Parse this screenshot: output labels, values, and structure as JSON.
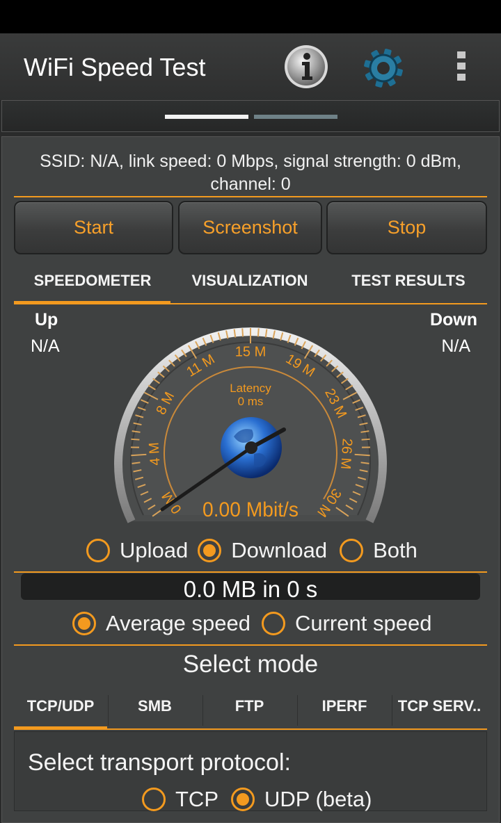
{
  "app": {
    "title": "WiFi Speed Test",
    "icons": [
      "info-icon",
      "gear-icon",
      "overflow-menu-icon"
    ]
  },
  "connection": {
    "info": "SSID: N/A, link speed: 0 Mbps, signal strength: 0 dBm, channel: 0"
  },
  "actions": {
    "start": "Start",
    "screenshot": "Screenshot",
    "stop": "Stop"
  },
  "tabs": [
    {
      "label": "SPEEDOMETER",
      "active": true
    },
    {
      "label": "VISUALIZATION",
      "active": false
    },
    {
      "label": "TEST RESULTS",
      "active": false
    }
  ],
  "speeds": {
    "up_label": "Up",
    "up_value": "N/A",
    "down_label": "Down",
    "down_value": "N/A"
  },
  "gauge": {
    "latency_label": "Latency",
    "latency_value": "0 ms",
    "speed_readout": "0.00 Mbit/s",
    "scale_labels": [
      "0 M",
      "4 M",
      "8 M",
      "11 M",
      "15 M",
      "19 M",
      "23 M",
      "26 M",
      "30 M"
    ],
    "needle_value_mbit": 0
  },
  "direction": {
    "upload": "Upload",
    "download": "Download",
    "both": "Both",
    "selected": "Download"
  },
  "transfer": "0.0 MB in 0 s",
  "speed_mode": {
    "average": "Average speed",
    "current": "Current speed",
    "selected": "Average speed"
  },
  "mode": {
    "title": "Select mode",
    "tabs": [
      "TCP/UDP",
      "SMB",
      "FTP",
      "IPERF",
      "TCP SERV.."
    ],
    "active": "TCP/UDP"
  },
  "transport": {
    "label": "Select transport protocol:",
    "tcp": "TCP",
    "udp": "UDP (beta)",
    "selected": "UDP (beta)"
  },
  "colors": {
    "accent": "#f39a1f",
    "background": "#3f4141",
    "appbar": "#333434"
  }
}
